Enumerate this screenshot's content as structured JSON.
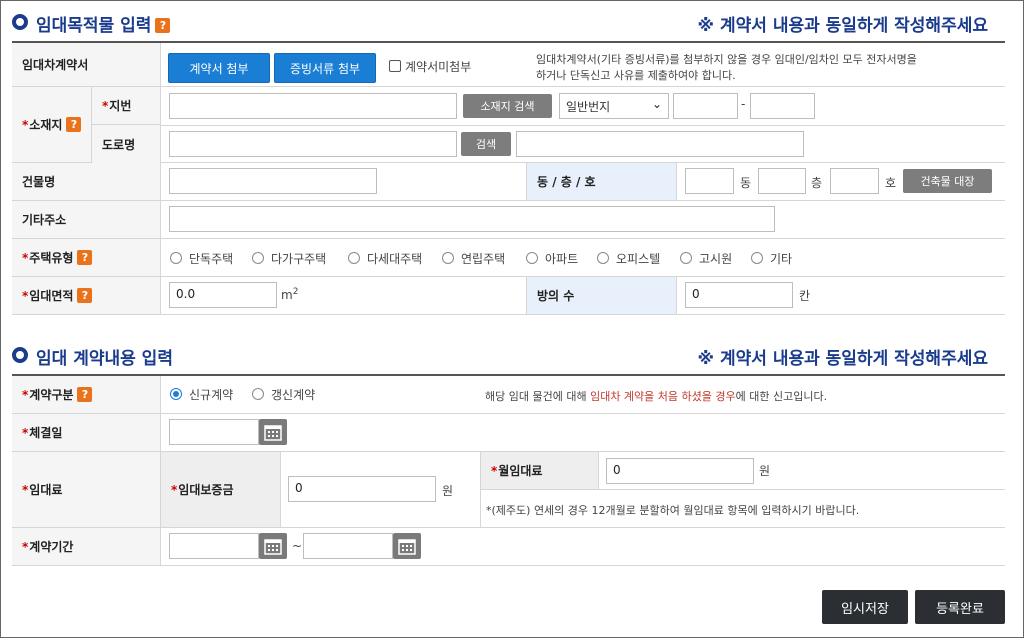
{
  "section1": {
    "title": "임대목적물 입력",
    "help": "?",
    "notice": "※ 계약서 내용과 동일하게 작성해주세요",
    "contract_row": {
      "label": "임대차계약서",
      "attach_contract": "계약서 첨부",
      "attach_evidence": "증빙서류 첨부",
      "no_contract_label": "계약서미첨부",
      "note_line1": "임대차계약서(기타 증빙서류)를 첨부하지 않을 경우 임대인/임차인 모두 전자서명을",
      "note_line2": "하거나 단독신고 사유를 제출하여야 합니다."
    },
    "location": {
      "label": "소재지",
      "lot_label": "지번",
      "lot_value": "",
      "search_button": "소재지 검색",
      "lot_type_selected": "일반번지",
      "lot_main": "",
      "dash": "-",
      "lot_sub": "",
      "road_label": "도로명",
      "road_value": "",
      "road_search_button": "검색",
      "road_detail": ""
    },
    "building": {
      "label": "건물명",
      "value": "",
      "dong_floor_label": "동 / 층 / 호",
      "dong": "",
      "dong_unit": "동",
      "floor": "",
      "floor_unit": "층",
      "ho": "",
      "ho_unit": "호",
      "ledger_button": "건축물 대장"
    },
    "other_address": {
      "label": "기타주소",
      "value": ""
    },
    "house_type": {
      "label": "주택유형",
      "options": [
        "단독주택",
        "다가구주택",
        "다세대주택",
        "연립주택",
        "아파트",
        "오피스텔",
        "고시원",
        "기타"
      ]
    },
    "area": {
      "label": "임대면적",
      "value": "0.0",
      "unit": "m",
      "unit_sup": "2",
      "rooms_label": "방의 수",
      "rooms_value": "0",
      "rooms_unit": "칸"
    }
  },
  "section2": {
    "title": "임대 계약내용 입력",
    "notice": "※ 계약서 내용과 동일하게 작성해주세요",
    "contract_type": {
      "label": "계약구분",
      "help": "?",
      "options": [
        "신규계약",
        "갱신계약"
      ],
      "selected_index": 0,
      "desc_prefix": "해당 임대 물건에 대해 ",
      "desc_highlight": "임대차 계약을 처음 하셨을 경우",
      "desc_suffix": "에 대한 신고입니다."
    },
    "signed_date": {
      "label": "체결일",
      "value": ""
    },
    "rent": {
      "label": "임대료",
      "deposit_label": "임대보증금",
      "deposit_value": "0",
      "deposit_unit": "원",
      "monthly_label": "월임대료",
      "monthly_value": "0",
      "monthly_unit": "원",
      "note": "*(제주도) 연세의 경우 12개월로 분할하여 월임대료 항목에 입력하시기 바랍니다."
    },
    "period": {
      "label": "계약기간",
      "start": "",
      "tilde": "~",
      "end": ""
    }
  },
  "footer": {
    "temp_save": "임시저장",
    "register": "등록완료"
  },
  "colors": {
    "accent_blue": "#1a7fd4",
    "title_navy": "#1b3c8c",
    "help_orange": "#e8731c",
    "highlight_red": "#c0392b"
  }
}
